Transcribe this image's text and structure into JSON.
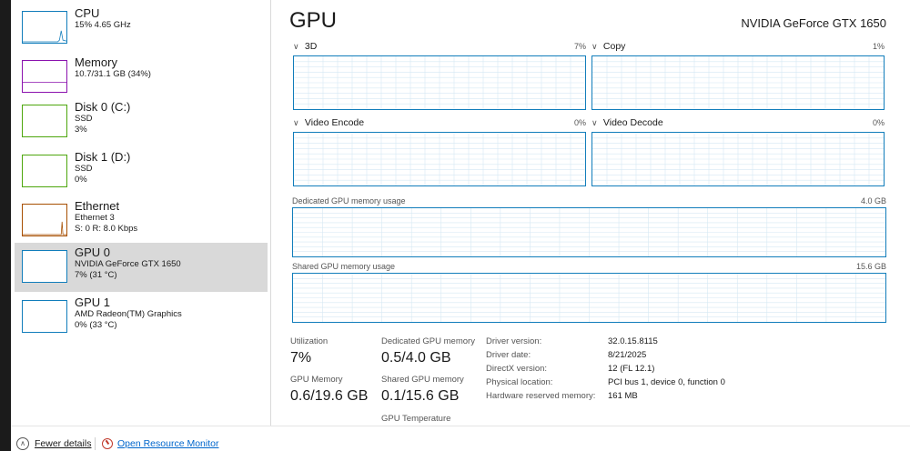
{
  "sidebar": {
    "items": [
      {
        "title": "CPU",
        "line1": "15% 4.65 GHz",
        "line2": "",
        "color": "#117dbb"
      },
      {
        "title": "Memory",
        "line1": "10.7/31.1 GB (34%)",
        "line2": "",
        "color": "#8b12ae"
      },
      {
        "title": "Disk 0 (C:)",
        "line1": "SSD",
        "line2": "3%",
        "color": "#4da60c"
      },
      {
        "title": "Disk 1 (D:)",
        "line1": "SSD",
        "line2": "0%",
        "color": "#4da60c"
      },
      {
        "title": "Ethernet",
        "line1": "Ethernet 3",
        "line2": "S: 0 R: 8.0 Kbps",
        "color": "#a74f01"
      },
      {
        "title": "GPU 0",
        "line1": "NVIDIA GeForce GTX 1650",
        "line2": "7% (31 °C)",
        "color": "#117dbb"
      },
      {
        "title": "GPU 1",
        "line1": "AMD Radeon(TM) Graphics",
        "line2": "0% (33 °C)",
        "color": "#117dbb"
      }
    ]
  },
  "main": {
    "title": "GPU",
    "gpu_name": "NVIDIA GeForce GTX 1650",
    "engines": [
      {
        "label": "3D",
        "percent": "7%"
      },
      {
        "label": "Copy",
        "percent": "1%"
      },
      {
        "label": "Video Encode",
        "percent": "0%"
      },
      {
        "label": "Video Decode",
        "percent": "0%"
      }
    ],
    "dedicated_memory": {
      "label": "Dedicated GPU memory usage",
      "max": "4.0 GB"
    },
    "shared_memory": {
      "label": "Shared GPU memory usage",
      "max": "15.6 GB"
    },
    "stats": {
      "utilization_label": "Utilization",
      "utilization_value": "7%",
      "gpu_memory_label": "GPU Memory",
      "gpu_memory_value": "0.6/19.6 GB",
      "dedicated_label": "Dedicated GPU memory",
      "dedicated_value": "0.5/4.0 GB",
      "shared_label": "Shared GPU memory",
      "shared_value": "0.1/15.6 GB",
      "temperature_label": "GPU Temperature"
    },
    "info": [
      {
        "key": "Driver version:",
        "value": "32.0.15.8115"
      },
      {
        "key": "Driver date:",
        "value": "8/21/2025"
      },
      {
        "key": "DirectX version:",
        "value": "12 (FL 12.1)"
      },
      {
        "key": "Physical location:",
        "value": "PCI bus 1, device 0, function 0"
      },
      {
        "key": "Hardware reserved memory:",
        "value": "161 MB"
      }
    ]
  },
  "footer": {
    "fewer_details": "Fewer details",
    "open_resource_monitor": "Open Resource Monitor"
  },
  "icons": {
    "chevron": "chevron-down-icon",
    "fewer_details": "chevron-up-circle-icon",
    "resource_monitor": "resource-monitor-icon"
  },
  "colors": {
    "graph_border": "#117dbb",
    "grid": "#d6e8f3",
    "selected_bg": "#d9d9d9",
    "link": "#0066cc"
  }
}
